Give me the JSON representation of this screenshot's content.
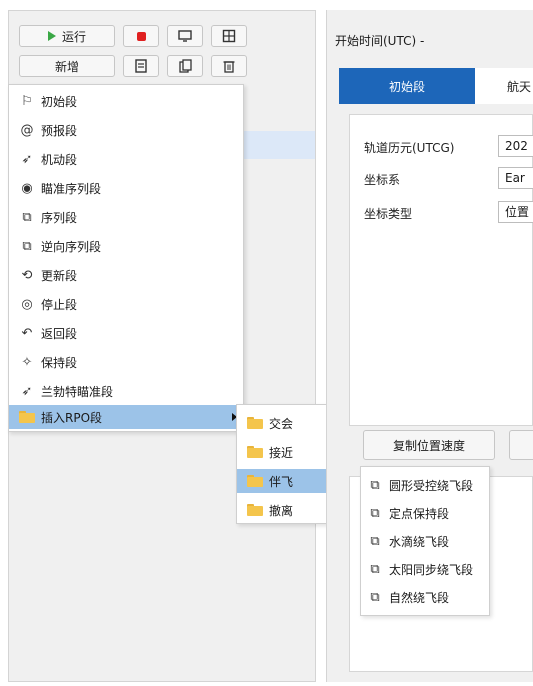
{
  "toolbar": {
    "run_label": "运行",
    "add_label": "新增"
  },
  "menu": {
    "items": [
      {
        "label": "初始段",
        "icon": "flag-icon"
      },
      {
        "label": "预报段",
        "icon": "forecast-icon"
      },
      {
        "label": "机动段",
        "icon": "rocket-icon"
      },
      {
        "label": "瞄准序列段",
        "icon": "target-icon"
      },
      {
        "label": "序列段",
        "icon": "sequence-icon"
      },
      {
        "label": "逆向序列段",
        "icon": "reverse-sequence-icon"
      },
      {
        "label": "更新段",
        "icon": "update-icon"
      },
      {
        "label": "停止段",
        "icon": "stop-icon"
      },
      {
        "label": "返回段",
        "icon": "return-icon"
      },
      {
        "label": "保持段",
        "icon": "pin-icon"
      },
      {
        "label": "兰勃特瞄准段",
        "icon": "lambert-icon"
      },
      {
        "label": "插入RPO段",
        "icon": "folder-icon"
      }
    ],
    "rpo_submenu": [
      {
        "label": "交会"
      },
      {
        "label": "接近"
      },
      {
        "label": "伴飞"
      },
      {
        "label": "撤离"
      }
    ],
    "flyaround_submenu": [
      {
        "label": "圆形受控绕飞段"
      },
      {
        "label": "定点保持段"
      },
      {
        "label": "水滴绕飞段"
      },
      {
        "label": "太阳同步绕飞段"
      },
      {
        "label": "自然绕飞段"
      }
    ]
  },
  "right": {
    "start_time_label": "开始时间(UTC)  -",
    "tab_initial": "初始段",
    "tab_other": "航天",
    "fields": [
      {
        "label": "轨道历元(UTCG)",
        "value": "202"
      },
      {
        "label": "坐标系",
        "value": "Ear"
      },
      {
        "label": "坐标类型",
        "value": "位置"
      }
    ],
    "copy_button": "复制位置速度"
  },
  "colors": {
    "accent": "#1d66b9",
    "highlight": "#9cc3e8",
    "folder": "#f4c54c"
  }
}
